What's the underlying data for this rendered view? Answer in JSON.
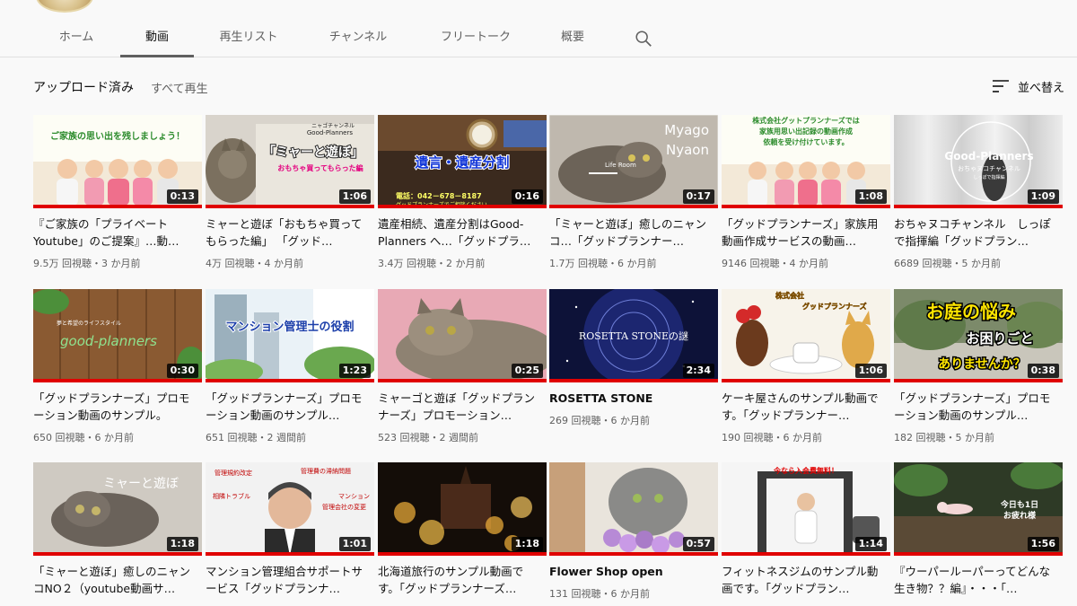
{
  "channel": {
    "avatar_icon": "channel-avatar"
  },
  "tabs": [
    {
      "label": "ホーム",
      "active": false
    },
    {
      "label": "動画",
      "active": true
    },
    {
      "label": "再生リスト",
      "active": false
    },
    {
      "label": "チャンネル",
      "active": false
    },
    {
      "label": "フリートーク",
      "active": false
    },
    {
      "label": "概要",
      "active": false
    }
  ],
  "section": {
    "title": "アップロード済み",
    "play_all": "すべて再生",
    "sort_label": "並べ替え"
  },
  "videos": [
    {
      "title": "『ご家族の「プライベートYoutube」のご提案』…動…",
      "meta": "9.5万 回視聴・3 か月前",
      "duration": "0:13",
      "thumb_texts": [
        "ご家族の思い出を残しましょう！"
      ]
    },
    {
      "title": "ミャーと遊ぼ「おもちゃ買ってもらった編」 「グッド…",
      "meta": "4万 回視聴・4 か月前",
      "duration": "1:06",
      "thumb_texts": [
        "ニャゴチャンネル",
        "Good-Planners",
        "「ミャーと遊ぼ」",
        "おもちゃ買ってもらった編"
      ]
    },
    {
      "title": "遺産相続、遺産分割はGood-Planners へ…「グッドプラ…",
      "meta": "3.4万 回視聴・2 か月前",
      "duration": "0:16",
      "thumb_texts": [
        "遺言・遺産分割",
        "電話：042－678－8187",
        "グッドプランナーズでご相談ください"
      ]
    },
    {
      "title": "「ミャーと遊ぼ」癒しのニャンコ…「グッドプランナー…",
      "meta": "1.7万 回視聴・6 か月前",
      "duration": "0:17",
      "thumb_texts": [
        "Myago",
        "Nyaon",
        "Life Room"
      ]
    },
    {
      "title": "「グッドプランナーズ」家族用動画作成サービスの動画…",
      "meta": "9146 回視聴・4 か月前",
      "duration": "1:08",
      "thumb_texts": [
        "株式会社グットプランナーズでは",
        "家族用思い出記録の動画作成",
        "依頼を受け付けています。"
      ]
    },
    {
      "title": "おちゃヌコチャンネル　しっぽで指揮編「グッドプラン…",
      "meta": "6689 回視聴・5 か月前",
      "duration": "1:09",
      "thumb_texts": [
        "Good-Planners",
        "おちゃヌコチャンネル",
        "しっぽで指揮編"
      ]
    },
    {
      "title": "「グッドプランナーズ」プロモーション動画のサンプル。",
      "meta": "650 回視聴・6 か月前",
      "duration": "0:30",
      "thumb_texts": [
        "夢と希望のライフスタイル",
        "good-planners"
      ]
    },
    {
      "title": "「グッドプランナーズ」プロモーション動画のサンプル…",
      "meta": "651 回視聴・2 週間前",
      "duration": "1:23",
      "thumb_texts": [
        "マンション管理士の役割"
      ]
    },
    {
      "title": "ミャーゴと遊ぼ「グッドプランナーズ」プロモーション…",
      "meta": "523 回視聴・2 週間前",
      "duration": "0:25",
      "thumb_texts": []
    },
    {
      "title": "ROSETTA STONE",
      "meta": "269 回視聴・6 か月前",
      "duration": "2:34",
      "thumb_texts": [
        "ROSETTA STONEの謎"
      ]
    },
    {
      "title": "ケーキ屋さんのサンプル動画です。「グッドプランナー…",
      "meta": "190 回視聴・6 か月前",
      "duration": "1:06",
      "thumb_texts": [
        "株式会社",
        "グッドプランナーズ"
      ]
    },
    {
      "title": "「グッドプランナーズ」プロモーション動画のサンプル…",
      "meta": "182 回視聴・5 か月前",
      "duration": "0:38",
      "thumb_texts": [
        "お庭の悩み",
        "お困りごと",
        "ありませんか？"
      ]
    },
    {
      "title": "「ミャーと遊ぼ」癒しのニャンコNO２（youtube動画サ…",
      "meta": "",
      "duration": "1:18",
      "thumb_texts": [
        "ミャーと遊ぼ"
      ]
    },
    {
      "title": "マンション管理組合サポートサービス「グッドプランナ…",
      "meta": "",
      "duration": "1:01",
      "thumb_texts": [
        "管理規約改定",
        "管理費の滞納問題",
        "相隣トラブル",
        "マンション",
        "管理会社の変更"
      ]
    },
    {
      "title": "北海道旅行のサンプル動画です。「グッドプランナーズ…",
      "meta": "",
      "duration": "1:18",
      "thumb_texts": []
    },
    {
      "title": "Flower Shop open",
      "meta": "131 回視聴・6 か月前",
      "duration": "0:57",
      "thumb_texts": []
    },
    {
      "title": "フィットネスジムのサンプル動画です。「グッドプラン…",
      "meta": "",
      "duration": "1:14",
      "thumb_texts": [
        "今なら入会費無料！"
      ]
    },
    {
      "title": "『ウーパールーパーってどんな生き物？？編』・・・「…",
      "meta": "",
      "duration": "1:56",
      "thumb_texts": [
        "今日も1日",
        "お疲れ様"
      ]
    }
  ]
}
